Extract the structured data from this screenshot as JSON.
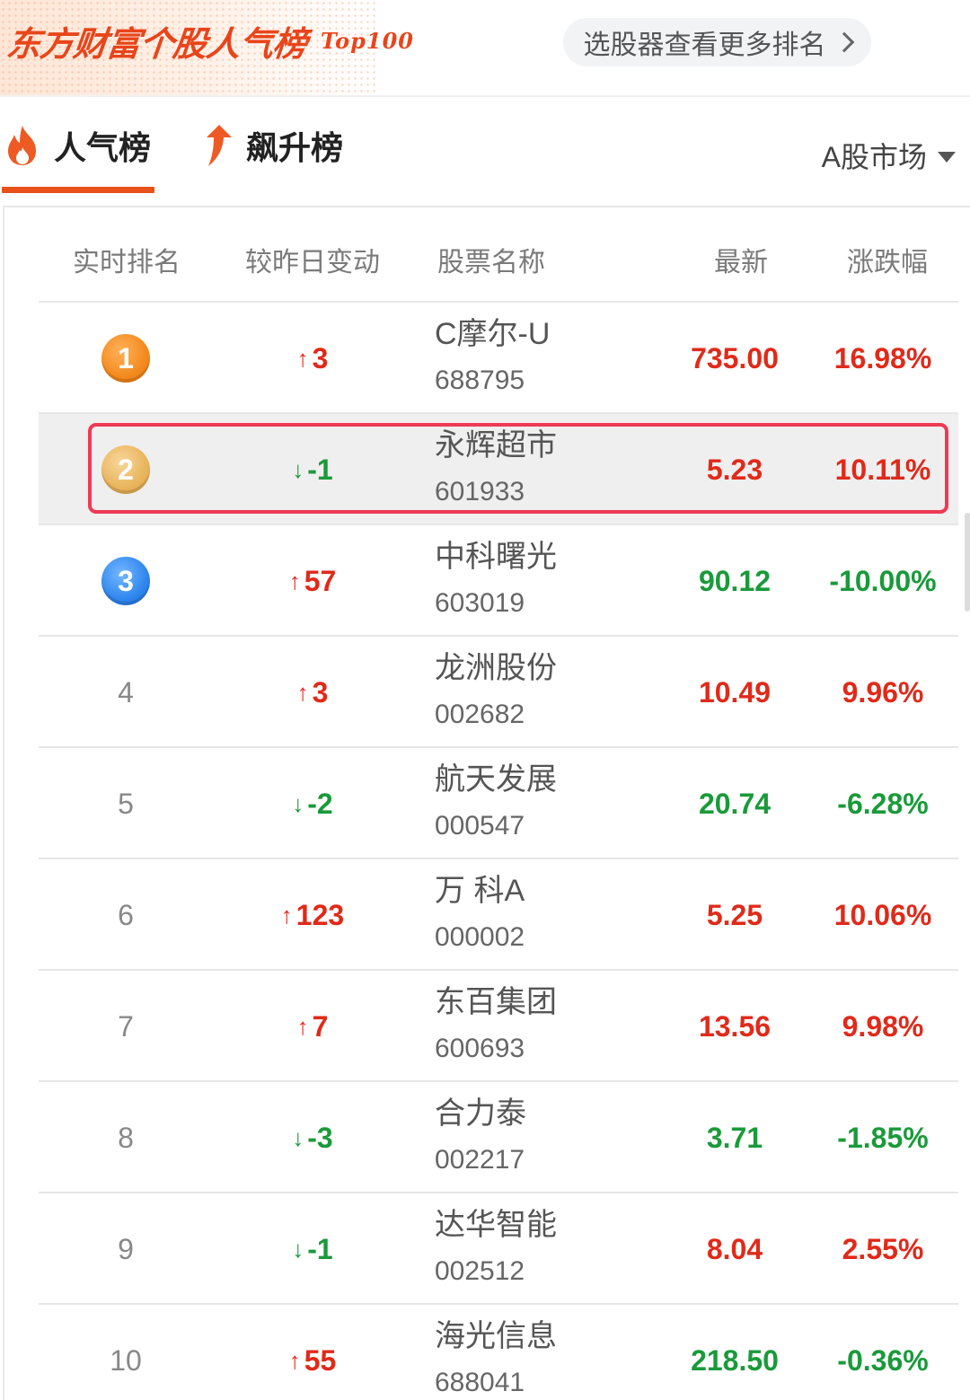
{
  "header": {
    "brand_title": "东方财富个股人气榜",
    "brand_sub": "Top100",
    "picker_label": "选股器查看更多排名"
  },
  "tabs": [
    {
      "label": "人气榜",
      "icon": "flame-icon",
      "active": true
    },
    {
      "label": "飙升榜",
      "icon": "rising-arrow-icon",
      "active": false
    }
  ],
  "market": {
    "label": "A股市场"
  },
  "table": {
    "headers": [
      "实时排名",
      "较昨日变动",
      "股票名称",
      "最新",
      "涨跌幅"
    ],
    "rows": [
      {
        "rank": "1",
        "change": "3",
        "dir": "up",
        "name": "C摩尔-U",
        "code": "688795",
        "price": "735.00",
        "pct": "16.98%",
        "trend": "up"
      },
      {
        "rank": "2",
        "change": "-1",
        "dir": "down",
        "name": "永辉超市",
        "code": "601933",
        "price": "5.23",
        "pct": "10.11%",
        "trend": "up"
      },
      {
        "rank": "3",
        "change": "57",
        "dir": "up",
        "name": "中科曙光",
        "code": "603019",
        "price": "90.12",
        "pct": "-10.00%",
        "trend": "down"
      },
      {
        "rank": "4",
        "change": "3",
        "dir": "up",
        "name": "龙洲股份",
        "code": "002682",
        "price": "10.49",
        "pct": "9.96%",
        "trend": "up"
      },
      {
        "rank": "5",
        "change": "-2",
        "dir": "down",
        "name": "航天发展",
        "code": "000547",
        "price": "20.74",
        "pct": "-6.28%",
        "trend": "down"
      },
      {
        "rank": "6",
        "change": "123",
        "dir": "up",
        "name": "万 科A",
        "code": "000002",
        "price": "5.25",
        "pct": "10.06%",
        "trend": "up"
      },
      {
        "rank": "7",
        "change": "7",
        "dir": "up",
        "name": "东百集团",
        "code": "600693",
        "price": "13.56",
        "pct": "9.98%",
        "trend": "up"
      },
      {
        "rank": "8",
        "change": "-3",
        "dir": "down",
        "name": "合力泰",
        "code": "002217",
        "price": "3.71",
        "pct": "-1.85%",
        "trend": "down"
      },
      {
        "rank": "9",
        "change": "-1",
        "dir": "down",
        "name": "达华智能",
        "code": "002512",
        "price": "8.04",
        "pct": "2.55%",
        "trend": "up"
      },
      {
        "rank": "10",
        "change": "55",
        "dir": "up",
        "name": "海光信息",
        "code": "688041",
        "price": "218.50",
        "pct": "-0.36%",
        "trend": "down"
      }
    ]
  },
  "colors": {
    "accent": "#e8511a",
    "up": "#e02a1a",
    "down": "#1a9a3a",
    "highlight": "#ee3a55"
  }
}
